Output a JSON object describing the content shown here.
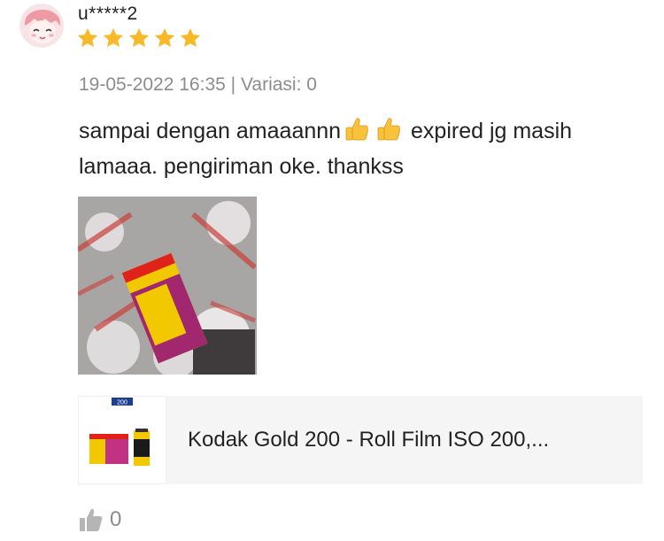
{
  "review": {
    "username": "u*****2",
    "rating": 5,
    "date": "19-05-2022 16:35",
    "separator": "|",
    "variation_label": "Variasi:",
    "variation_value": "0",
    "text_part1": "sampai dengan amaaannn",
    "text_part2": " expired jg masih lamaaa. pengiriman oke. thankss",
    "emoji": "thumbs-up-emoji",
    "photo": "review-photo-kodak-gold-package-in-bubble-wrap"
  },
  "product": {
    "title": "Kodak Gold 200 - Roll Film ISO 200,...",
    "thumbnail_badge": "200"
  },
  "likes": {
    "count": "0",
    "icon": "thumbs-up-icon"
  },
  "colors": {
    "star": "#f7b928",
    "meta_gray": "#8c8c8c",
    "card_bg": "#f5f5f5"
  }
}
